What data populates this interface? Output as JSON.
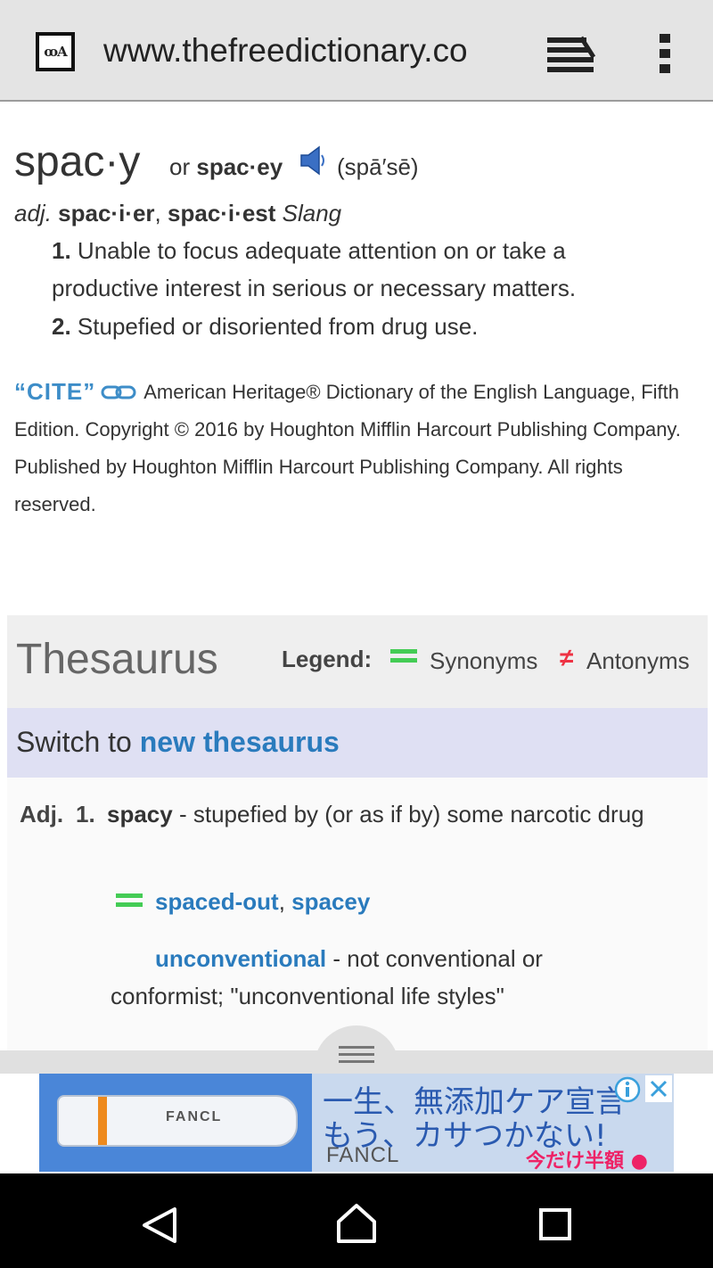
{
  "browser": {
    "url": "www.thefreedictionary.co",
    "site_icon_text": "ꝏA"
  },
  "entry": {
    "headword": "spac·y",
    "variant_or": "or",
    "variant_word": "spac·ey",
    "pronunciation": "(spā′sē)",
    "pos": "adj.",
    "comparative": "spac·i·er",
    "superlative": "spac·i·est",
    "comma": ",",
    "label": "Slang",
    "senses": [
      {
        "num": "1.",
        "text": "Unable to focus adequate attention on or take a productive interest in serious or necessary matters."
      },
      {
        "num": "2.",
        "text": "Stupefied or disoriented from drug use."
      }
    ]
  },
  "citation": {
    "badge": "“CITE”",
    "text": "American Heritage® Dictionary of the English Language, Fifth Edition. Copyright © 2016 by Houghton Mifflin Harcourt Publishing Company. Published by Houghton Mifflin Harcourt Publishing Company. All rights reserved."
  },
  "thesaurus": {
    "title": "Thesaurus",
    "legend_label": "Legend:",
    "synonyms_label": "Synonyms",
    "antonyms_label": "Antonyms",
    "antonym_symbol": "≠",
    "switch_prefix": "Switch to",
    "switch_link": "new thesaurus",
    "pos": "Adj.",
    "num": "1.",
    "word": "spacy",
    "definition": "- stupefied by (or as if by) some narcotic drug",
    "synonyms": [
      "spaced-out",
      "spacey"
    ],
    "related_word": "unconventional",
    "related_def": "- not conventional or conformist; \"unconventional life styles\""
  },
  "ad": {
    "line1": "一生、無添加ケア宣言",
    "line2": "もう、カサつかない!",
    "brand": "FANCL",
    "tube_brand": "FANCL",
    "sale": "今だけ半額"
  },
  "colors": {
    "link": "#2a7bbd",
    "synonym_green": "#44cc55",
    "antonym_red": "#ee3344",
    "switch_bg": "#dfe0f3"
  }
}
